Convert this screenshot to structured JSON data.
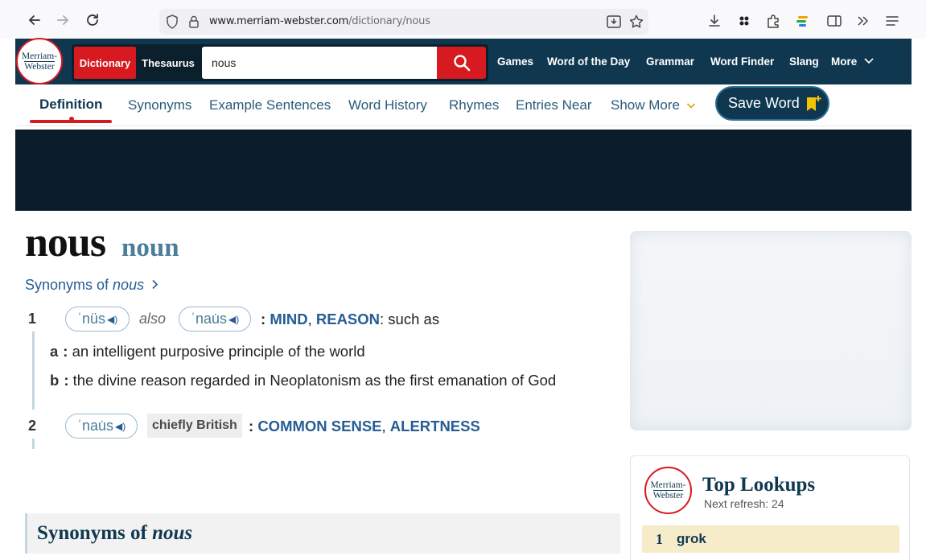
{
  "browser": {
    "url_host": "www.merriam-webster.com",
    "url_path": "/dictionary/nous"
  },
  "header": {
    "logo_line1": "Merriam-",
    "logo_line2": "Webster",
    "tab_dictionary": "Dictionary",
    "tab_thesaurus": "Thesaurus",
    "search_value": "nous",
    "nav": [
      "Games",
      "Word of the Day",
      "Grammar",
      "Word Finder",
      "Slang",
      "More"
    ]
  },
  "subnav": {
    "items": [
      "Definition",
      "Synonyms",
      "Example Sentences",
      "Word History",
      "Rhymes",
      "Entries Near",
      "Show More"
    ],
    "save_word": "Save Word"
  },
  "entry": {
    "headword": "nous",
    "pos": "noun",
    "synonyms_link_prefix": "Synonyms of ",
    "synonyms_link_word": "nous",
    "senses": [
      {
        "num": "1",
        "pron1": "ˈnüs",
        "also": "also",
        "pron2": "ˈnau̇s",
        "sx1": "MIND",
        "sx2": "REASON",
        "tail": ": such as",
        "sub": [
          {
            "letter": "a",
            "text": "an intelligent purposive principle of the world"
          },
          {
            "letter": "b",
            "text": "the divine reason regarded in Neoplatonism as the first emanation of God"
          }
        ]
      },
      {
        "num": "2",
        "pron": "ˈnau̇s",
        "label": "chiefly British",
        "sx1": "COMMON SENSE",
        "sx2": "ALERTNESS"
      }
    ],
    "synonyms_heading_prefix": "Synonyms of ",
    "synonyms_heading_word": "nous"
  },
  "top_lookups": {
    "title": "Top Lookups",
    "refresh": "Next refresh: 24",
    "items": [
      {
        "rank": "1",
        "word": "grok"
      }
    ]
  },
  "colors": {
    "brand_navy": "#0f3850",
    "brand_red": "#d71920",
    "link_blue": "#265d94"
  }
}
